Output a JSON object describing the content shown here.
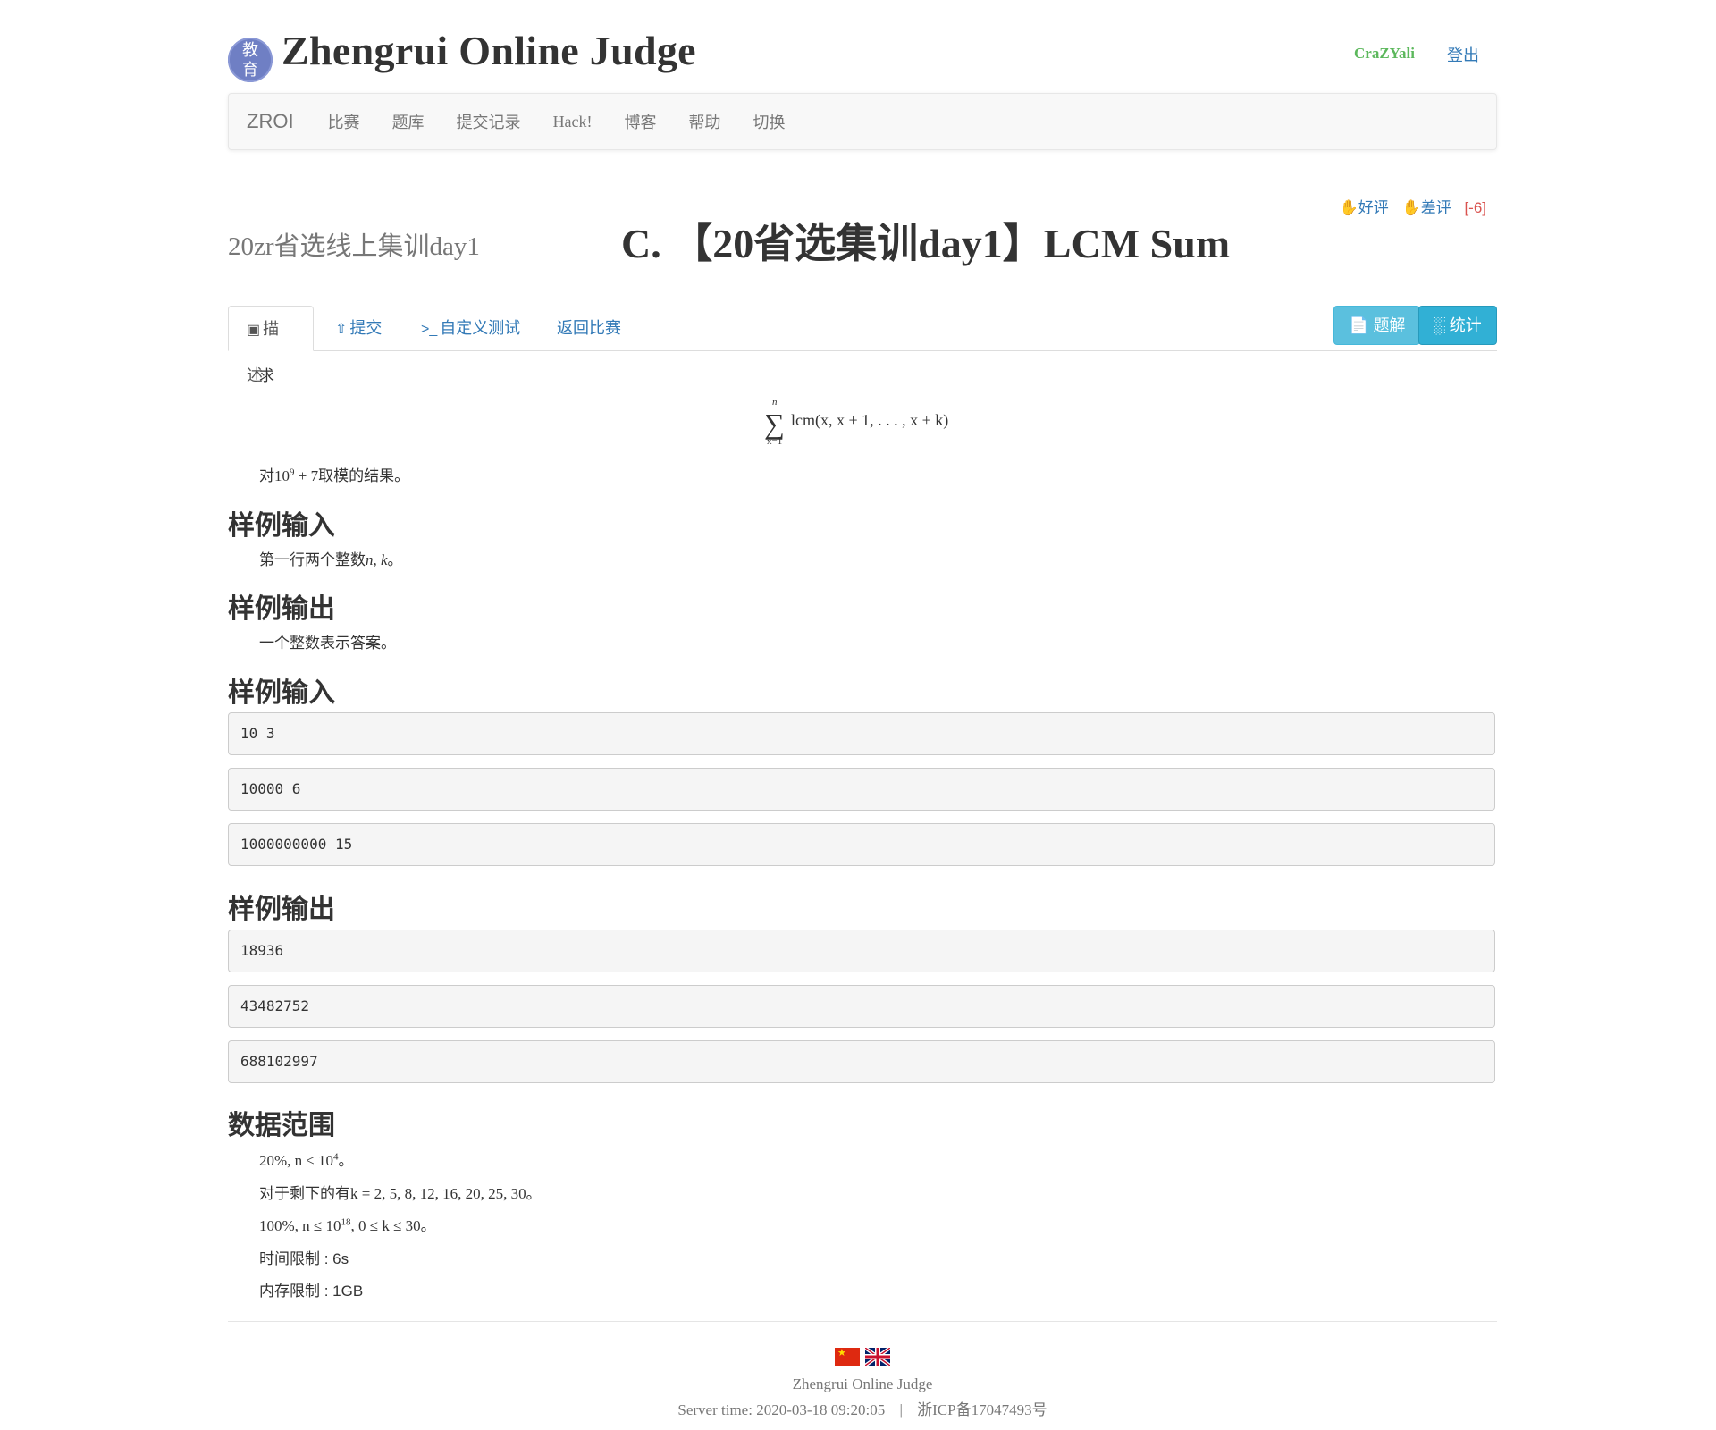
{
  "header": {
    "logo_text_top": "教",
    "logo_text_bottom": "育",
    "site_title": "Zhengrui Online Judge",
    "username": "CraZYali",
    "logout": "登出"
  },
  "navbar": {
    "brand": "ZROI",
    "items": [
      "比赛",
      "题库",
      "提交记录",
      "Hack!",
      "博客",
      "帮助",
      "切换"
    ]
  },
  "rating": {
    "up": "好评",
    "down": "差评",
    "score": "[-6]"
  },
  "problem": {
    "contest": "20zr省选线上集训day1",
    "title": "C. 【20省选集训day1】LCM Sum"
  },
  "tabs": {
    "description": "描述",
    "submit": "提交",
    "custom_test": "自定义测试",
    "back": "返回比赛"
  },
  "buttons": {
    "solution": "题解",
    "stats": "统计"
  },
  "content": {
    "intro": "求",
    "formula_upper": "n",
    "formula_lower": "x=1",
    "formula_body": "lcm(x, x + 1, . . . , x + k)",
    "mod_prefix": "对",
    "mod_expr": "10",
    "mod_exp": "9",
    "mod_rest": " + 7",
    "mod_suffix": "取模的结果。",
    "input_heading": "样例输入",
    "input_desc_prefix": "第一行两个整数",
    "input_desc_vars": "n, k",
    "input_desc_suffix": "。",
    "output_heading": "样例输出",
    "output_desc": "一个整数表示答案。",
    "sample_input_heading": "样例输入",
    "sample_inputs": [
      "10 3",
      "10000 6",
      "1000000000 15"
    ],
    "sample_output_heading": "样例输出",
    "sample_outputs": [
      "18936",
      "43482752",
      "688102997"
    ],
    "range_heading": "数据范围",
    "range_1_a": "20%, n ≤ 10",
    "range_1_exp": "4",
    "range_1_b": "。",
    "range_2_prefix": "对于剩下的有",
    "range_2_math": "k = 2, 5, 8, 12, 16, 20, 25, 30",
    "range_2_suffix": "。",
    "range_3_a": "100%, n ≤ 10",
    "range_3_exp": "18",
    "range_3_b": ", 0 ≤ k ≤ 30",
    "range_3_c": "。",
    "time_limit": "时间限制 : 6s",
    "memory_limit": "内存限制 : 1GB"
  },
  "footer": {
    "name": "Zhengrui Online Judge",
    "server_time": "Server time: 2020-03-18 09:20:05",
    "separator": "|",
    "icp": "浙ICP备17047493号"
  },
  "colors": {
    "link": "#337ab7",
    "user": "#5cb85c",
    "score": "#d9534f",
    "info_button": "#5bc0de"
  },
  "icons": [
    "thumbs-up-icon",
    "thumbs-down-icon",
    "book-icon",
    "upload-icon",
    "terminal-icon",
    "file-icon",
    "bar-chart-icon",
    "flag-cn-icon",
    "flag-gb-icon"
  ]
}
